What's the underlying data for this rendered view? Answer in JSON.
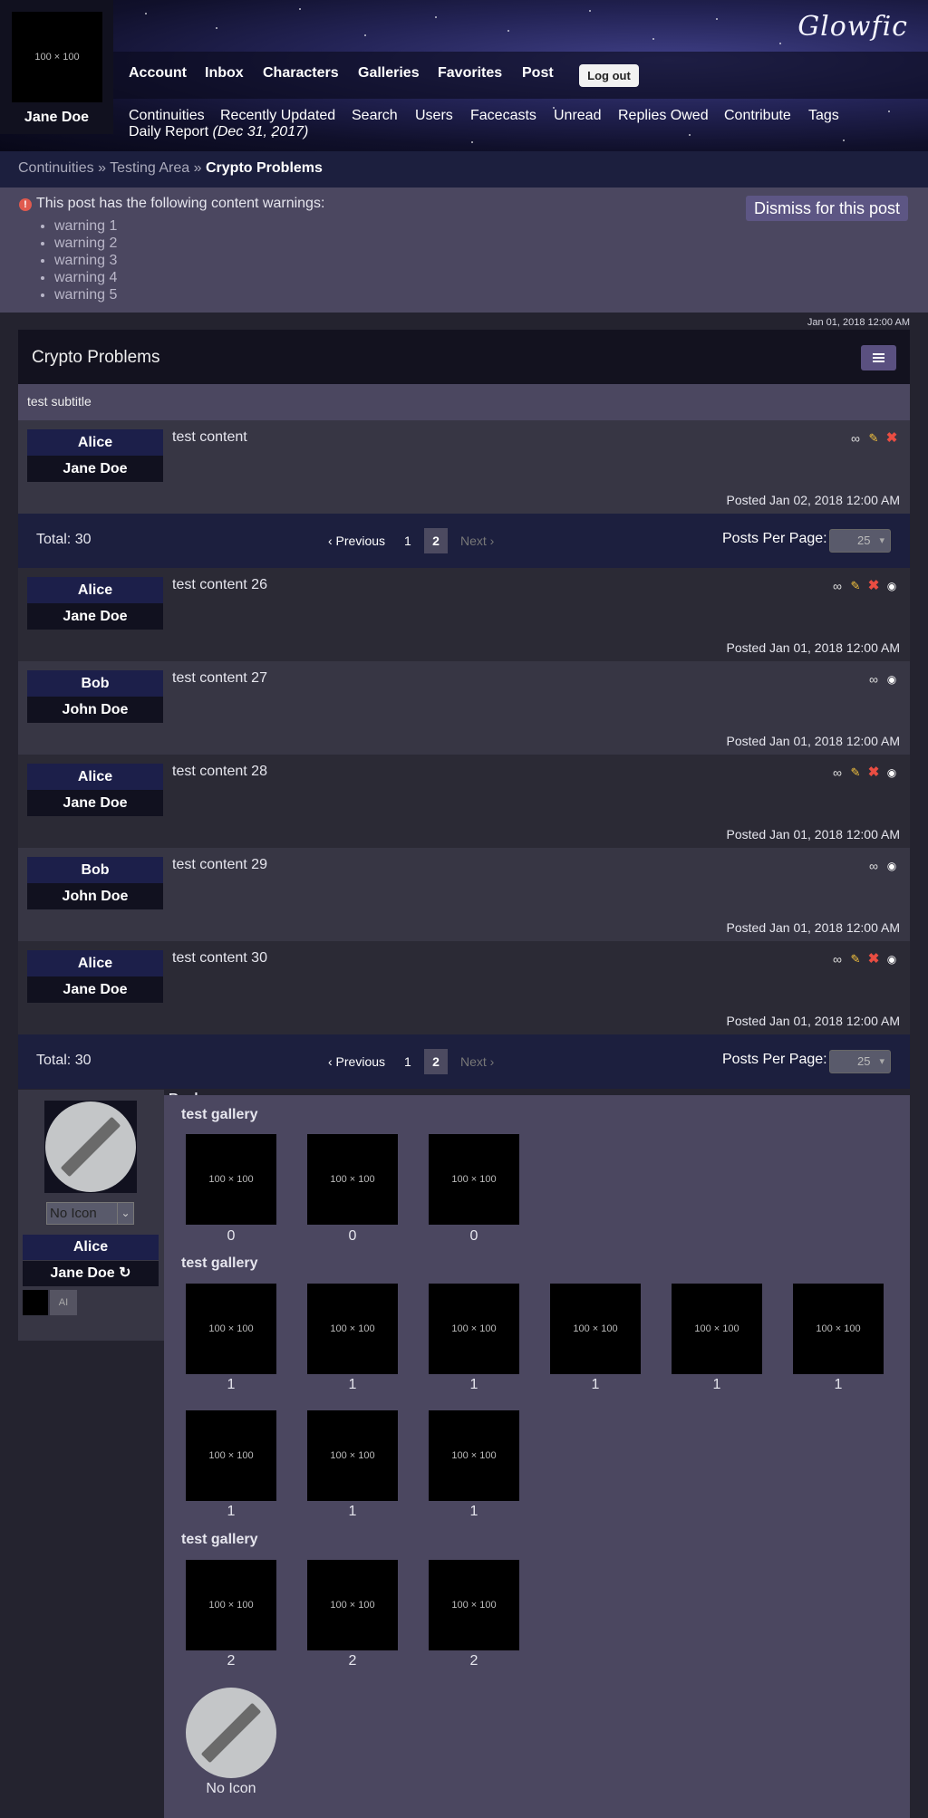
{
  "header": {
    "logo": "Glowfic",
    "avatar_placeholder": "100 × 100",
    "username": "Jane Doe",
    "nav": [
      "Account",
      "Inbox",
      "Characters",
      "Galleries",
      "Favorites",
      "Post"
    ],
    "logout": "Log out",
    "subnav": [
      "Continuities",
      "Recently Updated",
      "Search",
      "Users",
      "Facecasts",
      "Unread",
      "Replies Owed",
      "Contribute",
      "Tags"
    ],
    "daily_report": "Daily Report",
    "daily_date": "(Dec 31, 2017)"
  },
  "breadcrumb": {
    "items": [
      "Continuities",
      "Testing Area"
    ],
    "separator": "»",
    "current": "Crypto Problems"
  },
  "warnings": {
    "heading": "This post has the following content warnings:",
    "items": [
      "warning 1",
      "warning 2",
      "warning 3",
      "warning 4",
      "warning 5"
    ],
    "dismiss": "Dismiss for this post"
  },
  "post": {
    "timestamp": "Jan 01, 2018 12:00 AM",
    "title": "Crypto Problems",
    "subtitle": "test subtitle",
    "main": {
      "character": "Alice",
      "user": "Jane Doe",
      "content": "test content",
      "posted": "Posted Jan 02, 2018 12:00 AM"
    }
  },
  "pagination": {
    "total": "Total: 30",
    "prev": "‹ Previous",
    "page1": "1",
    "page2": "2",
    "next": "Next ›",
    "per_page_label": "Posts Per Page:",
    "per_page_value": "25"
  },
  "replies": [
    {
      "character": "Alice",
      "user": "Jane Doe",
      "content": "test content 26",
      "posted": "Posted Jan 01, 2018 12:00 AM"
    },
    {
      "character": "Bob",
      "user": "John Doe",
      "content": "test content 27",
      "posted": "Posted Jan 01, 2018 12:00 AM"
    },
    {
      "character": "Alice",
      "user": "Jane Doe",
      "content": "test content 28",
      "posted": "Posted Jan 01, 2018 12:00 AM"
    },
    {
      "character": "Bob",
      "user": "John Doe",
      "content": "test content 29",
      "posted": "Posted Jan 01, 2018 12:00 AM"
    },
    {
      "character": "Alice",
      "user": "Jane Doe",
      "content": "test content 30",
      "posted": "Posted Jan 01, 2018 12:00 AM"
    }
  ],
  "editor": {
    "icon_select": "No Icon",
    "character": "Alice",
    "user": "Jane Doe",
    "ai_button": "AI",
    "peek_text": "Reply"
  },
  "gallery": {
    "groups": [
      {
        "name": "test gallery",
        "items": [
          "0",
          "0",
          "0"
        ]
      },
      {
        "name": "test gallery",
        "items": [
          "1",
          "1",
          "1",
          "1",
          "1",
          "1",
          "1",
          "1",
          "1"
        ]
      },
      {
        "name": "test gallery",
        "items": [
          "2",
          "2",
          "2"
        ]
      }
    ],
    "placeholder": "100 × 100",
    "no_icon_label": "No Icon"
  },
  "colors": {
    "accent": "#5a5080",
    "header_bar": "#1c1f3e",
    "delete": "#e94d42",
    "edit": "#f3c23e"
  },
  "icons": {
    "link": "link-icon",
    "edit": "pencil-icon",
    "delete": "delete-x-icon",
    "watch": "eye-icon",
    "switch": "swap-icon",
    "warning": "exclamation-icon"
  }
}
